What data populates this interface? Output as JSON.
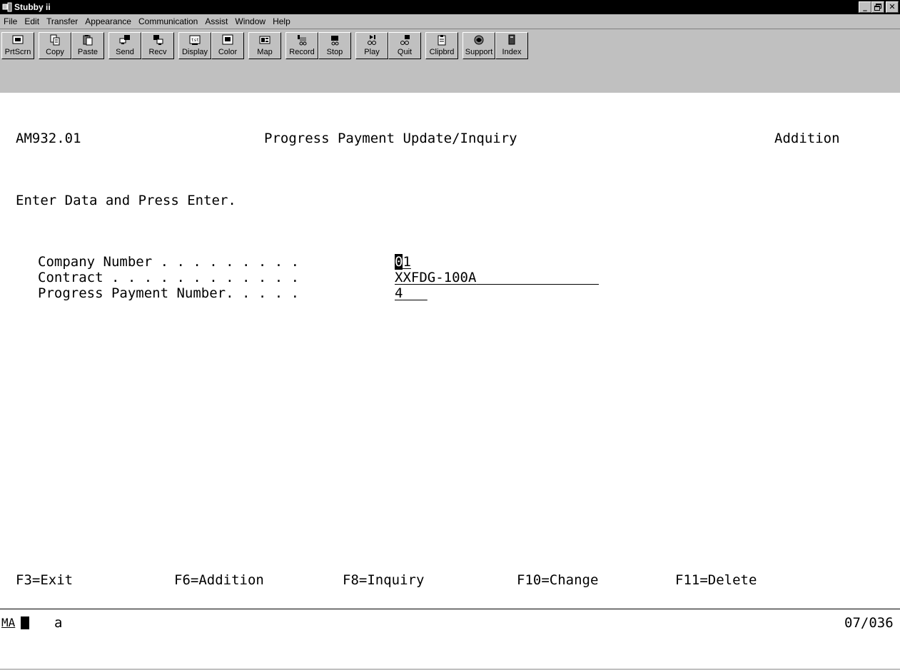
{
  "window": {
    "title": "Stubby ii",
    "buttons": {
      "minimize": "_",
      "maximize": "▫",
      "close": "✕"
    }
  },
  "menu": [
    {
      "label": "File"
    },
    {
      "label": "Edit"
    },
    {
      "label": "Transfer"
    },
    {
      "label": "Appearance"
    },
    {
      "label": "Communication"
    },
    {
      "label": "Assist"
    },
    {
      "label": "Window"
    },
    {
      "label": "Help"
    }
  ],
  "toolbar": [
    {
      "label": "PrtScrn",
      "icon": "printscreen-icon"
    },
    {
      "label": "Copy",
      "icon": "copy-icon"
    },
    {
      "label": "Paste",
      "icon": "paste-icon"
    },
    {
      "label": "Send",
      "icon": "send-icon"
    },
    {
      "label": "Recv",
      "icon": "receive-icon"
    },
    {
      "label": "Display",
      "icon": "display-icon"
    },
    {
      "label": "Color",
      "icon": "color-icon"
    },
    {
      "label": "Map",
      "icon": "map-icon"
    },
    {
      "label": "Record",
      "icon": "record-icon"
    },
    {
      "label": "Stop",
      "icon": "stop-icon"
    },
    {
      "label": "Play",
      "icon": "play-icon"
    },
    {
      "label": "Quit",
      "icon": "quit-icon"
    },
    {
      "label": "Clipbrd",
      "icon": "clipboard-icon"
    },
    {
      "label": "Support",
      "icon": "support-icon"
    },
    {
      "label": "Index",
      "icon": "index-icon"
    }
  ],
  "screen": {
    "program_id": "AM932.01",
    "heading": "Progress Payment Update/Inquiry",
    "mode": "Addition",
    "instruction": "Enter Data and Press Enter.",
    "fields": {
      "company_label": "Company Number . . . . . . . . .",
      "company_value_first": "0",
      "company_value_rest": "1",
      "contract_label": "Contract . . . . . . . . . . . .",
      "contract_value": "XXFDG-100A",
      "progress_label": "Progress Payment Number. . . . .",
      "progress_value": "4"
    },
    "function_keys": {
      "f3": "F3=Exit",
      "f6": "F6=Addition",
      "f8": "F8=Inquiry",
      "f10": "F10=Change",
      "f11": "F11=Delete"
    }
  },
  "status": {
    "indicator": "MA",
    "mode_char": "a",
    "cursor_position": "07/036"
  }
}
